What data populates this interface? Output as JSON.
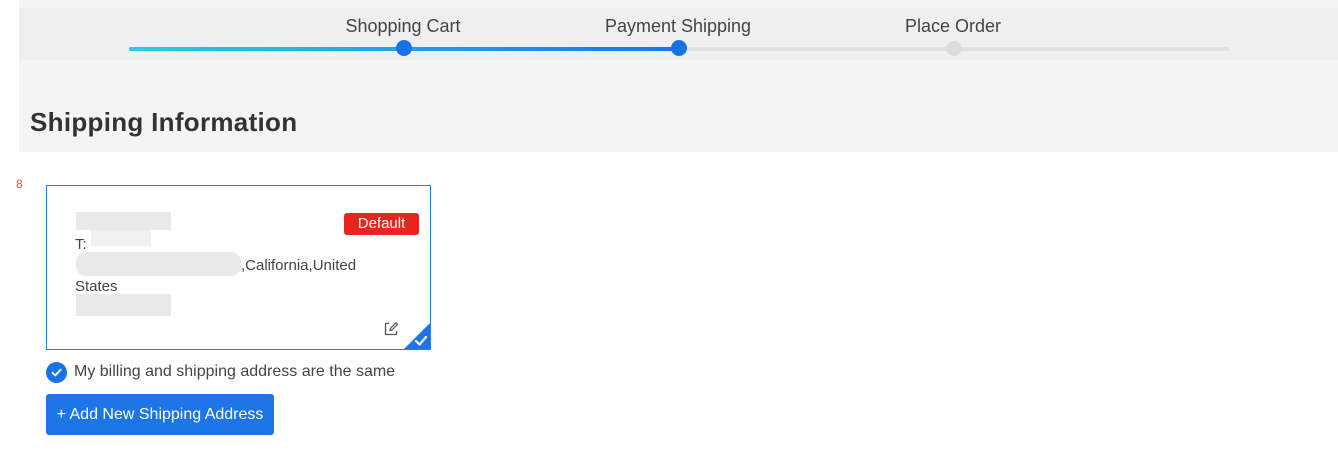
{
  "stepper": {
    "steps": [
      {
        "label": "Shopping Cart",
        "state": "complete"
      },
      {
        "label": "Payment Shipping",
        "state": "current"
      },
      {
        "label": "Place Order",
        "state": "upcoming"
      }
    ],
    "progress_percent": 50,
    "gradient_colors": [
      "#30c8e8",
      "#1a75e8"
    ]
  },
  "section": {
    "title": "Shipping Information",
    "marker": "8"
  },
  "address_card": {
    "badge": "Default",
    "phone_prefix": "T:",
    "address_line_suffix": ",California,United",
    "address_line_2": "States",
    "selected": true,
    "edit_icon": "edit-icon",
    "selected_icon": "checkmark-icon"
  },
  "billing_same": {
    "label": "My billing and shipping address are the same",
    "checked": true
  },
  "add_button": {
    "label": "+ Add New Shipping Address"
  },
  "colors": {
    "accent": "#1a72e8",
    "badge": "#e6261f",
    "page_bg": "#f4f4f4"
  }
}
